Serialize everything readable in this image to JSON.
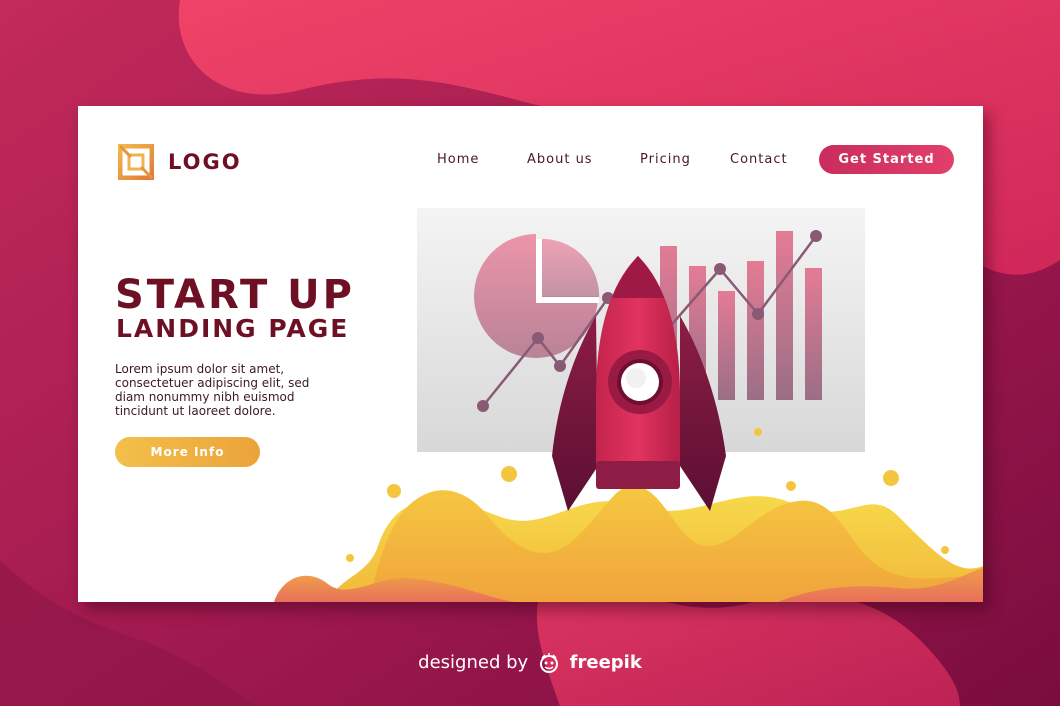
{
  "brand": {
    "logo_text": "LOGO",
    "logo_icon": "square-frame-icon"
  },
  "nav": {
    "items": [
      "Home",
      "About us",
      "Pricing",
      "Contact"
    ]
  },
  "header": {
    "cta_label": "Get Started"
  },
  "hero": {
    "title": "START UP",
    "subtitle": "LANDING PAGE",
    "body": "Lorem ipsum dolor sit amet,\nconsectetuer adipiscing elit, sed\ndiam nonummy nibh euismod\ntincidunt ut laoreet dolore.",
    "button_label": "More Info"
  },
  "illustration": {
    "icons": [
      "rocket-icon",
      "pie-chart-icon",
      "bar-chart-icon",
      "line-chart-icon"
    ]
  },
  "footer": {
    "credit_prefix": "designed by",
    "credit_brand": "freepik"
  },
  "colors": {
    "primary": "#6e1024",
    "accent": "#d6335f",
    "cta": "#e2406a",
    "secondary_button": "#f0b23f",
    "background": "#a01c4e"
  }
}
